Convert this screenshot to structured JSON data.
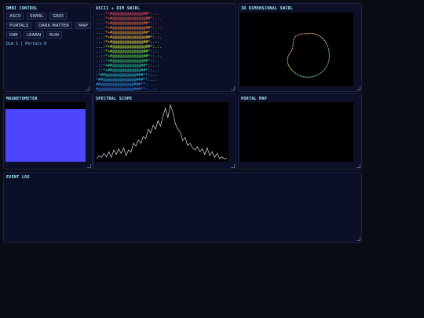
{
  "panels": {
    "omni": {
      "title": "OMNI CONTROL",
      "buttons": [
        "ASCII",
        "SWIRL",
        "GRID",
        "PORTALS",
        "DARK MATTER",
        "MAP",
        "DIM",
        "LEARN",
        "RUN"
      ],
      "status": "Dim 1 | Portals 0"
    },
    "ascii": {
      "title": "ASCII + DIM SWIRL",
      "lines": [
        "...:*+#@@@@@@@@@@@@@##*:.:.",
        "...:*+#@@@@@@@@@@@@@@##*:.:.",
        "...:*+#@@@@@@@@@@@@@##*:.:.",
        "...:*+#@@@@@@@@@@@@@@##*:.:.",
        "...:*+#@@@@@@@@@@@@@##*:.:.",
        "...:*+#@@@@@@@@@@@@@@##*:.:.",
        "...:*+#@@@@@@@@@@@@@##*:.:.",
        "...:*+#@@@@@@@@@@@@@@##*:.:.",
        "..::*+#@@@@@@@@@@@@@##*:.:.",
        "..::*+#@@@@@@@@@@@@@##*::.:.",
        "..::*+#@@@@@@@@@@@@@##*::..",
        ".::*+##@@@@@@@@@@@@##*::..:",
        ".::*+##@@@@@@@@@@@@##*::...",
        ":*##@@@@@@@@@@@@@###**::..",
        "*##@@@@@@@@@@@@@@###**:..:",
        "##@@@@@@@@@@@@@@###**:...",
        "#@@@@@@@@@@@@@@@###**:...:",
        "###@@@@@@@@@@@@@###*:...::"
      ],
      "line_colors": [
        "#ff4d5e",
        "#ff5a52",
        "#ff6a4a",
        "#ff8a3a",
        "#ffa93a",
        "#ffc93a",
        "#f2e23a",
        "#c7ef3a",
        "#8ef03c",
        "#5be84a",
        "#3cdc6a",
        "#2fd68e",
        "#2cd3b0",
        "#2bc8d0",
        "#2ab6e6",
        "#2f9ef2",
        "#3a86f5",
        "#4a6ef7"
      ]
    },
    "swirl": {
      "title": "3D DIMENSIONAL SWIRL"
    },
    "magnetometer": {
      "title": "MAGNETOMETER",
      "fill_color": "#4d45ff",
      "level": 0.88
    },
    "spectral": {
      "title": "SPECTRAL SCOPE",
      "trace_color": "#d8e0e8",
      "values": [
        3,
        8,
        5,
        12,
        6,
        15,
        5,
        18,
        10,
        20,
        12,
        22,
        8,
        18,
        14,
        30,
        25,
        36,
        30,
        42,
        38,
        55,
        48,
        62,
        55,
        70,
        60,
        78,
        92,
        75,
        98,
        85,
        65,
        55,
        50,
        35,
        40,
        26,
        30,
        22,
        18,
        24,
        15,
        20,
        10,
        22,
        8,
        15,
        5,
        12,
        3,
        6,
        2,
        4
      ]
    },
    "portal_map": {
      "title": "PORTAL MAP"
    },
    "event_log": {
      "title": "EVENT LOG"
    }
  }
}
